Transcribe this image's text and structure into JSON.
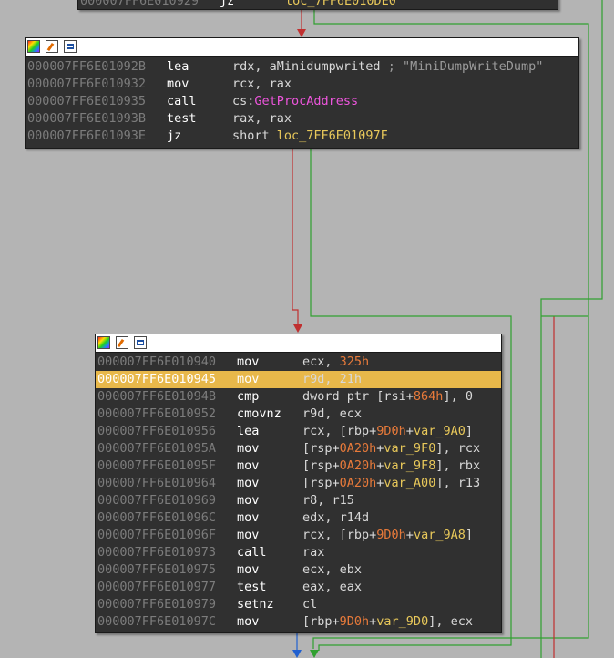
{
  "colors": {
    "background": "#b4b4b4",
    "node_bg": "#303030",
    "address": "#7c7c7c",
    "mnemonic": "#ffffff",
    "operand": "#d8d8d8",
    "number": "#e87a3a",
    "symbol": "#e8c85a",
    "import": "#ee55dd",
    "comment": "#9a9a9a",
    "highlight": "#e8b84a",
    "edge_false": "#c03030",
    "edge_true": "#30a030",
    "edge_normal": "#2060d0"
  },
  "node_header_icons": [
    "colors-icon",
    "rename-icon",
    "graph-overview-icon"
  ],
  "nodes": [
    {
      "id": "block-top-partial",
      "rows": [
        {
          "addr": "000007FF6E010929",
          "mnem": "jz",
          "ops": [
            {
              "t": "loc_7FF6E010DE0",
              "c": "sym"
            }
          ]
        }
      ]
    },
    {
      "id": "block-getprocaddress",
      "rows": [
        {
          "addr": "000007FF6E01092B",
          "mnem": "lea",
          "ops": [
            {
              "t": "rdx, "
            },
            {
              "t": "aMinidumpwrited",
              "c": "plain"
            },
            {
              "t": " ; \"MiniDumpWriteDump\"",
              "c": "cmt"
            }
          ]
        },
        {
          "addr": "000007FF6E010932",
          "mnem": "mov",
          "ops": [
            {
              "t": "rcx, rax"
            }
          ]
        },
        {
          "addr": "000007FF6E010935",
          "mnem": "call",
          "ops": [
            {
              "t": "cs:"
            },
            {
              "t": "GetProcAddress",
              "c": "imp"
            }
          ]
        },
        {
          "addr": "000007FF6E01093B",
          "mnem": "test",
          "ops": [
            {
              "t": "rax, rax"
            }
          ]
        },
        {
          "addr": "000007FF6E01093E",
          "mnem": "jz",
          "ops": [
            {
              "t": "short "
            },
            {
              "t": "loc_7FF6E01097F",
              "c": "sym"
            }
          ]
        }
      ]
    },
    {
      "id": "block-minidump-call",
      "rows": [
        {
          "addr": "000007FF6E010940",
          "mnem": "mov",
          "ops": [
            {
              "t": "ecx, "
            },
            {
              "t": "325h",
              "c": "num"
            }
          ]
        },
        {
          "addr": "000007FF6E010945",
          "mnem": "mov",
          "ops": [
            {
              "t": "r9d, 21h"
            }
          ],
          "highlight": true
        },
        {
          "addr": "000007FF6E01094B",
          "mnem": "cmp",
          "ops": [
            {
              "t": "dword ptr [rsi+"
            },
            {
              "t": "864h",
              "c": "num"
            },
            {
              "t": "], 0"
            }
          ]
        },
        {
          "addr": "000007FF6E010952",
          "mnem": "cmovnz",
          "ops": [
            {
              "t": "r9d, ecx"
            }
          ]
        },
        {
          "addr": "000007FF6E010956",
          "mnem": "lea",
          "ops": [
            {
              "t": "rcx, [rbp+"
            },
            {
              "t": "9D0h",
              "c": "num"
            },
            {
              "t": "+"
            },
            {
              "t": "var_9A0",
              "c": "sym"
            },
            {
              "t": "]"
            }
          ]
        },
        {
          "addr": "000007FF6E01095A",
          "mnem": "mov",
          "ops": [
            {
              "t": "[rsp+"
            },
            {
              "t": "0A20h",
              "c": "num"
            },
            {
              "t": "+"
            },
            {
              "t": "var_9F0",
              "c": "sym"
            },
            {
              "t": "], rcx"
            }
          ]
        },
        {
          "addr": "000007FF6E01095F",
          "mnem": "mov",
          "ops": [
            {
              "t": "[rsp+"
            },
            {
              "t": "0A20h",
              "c": "num"
            },
            {
              "t": "+"
            },
            {
              "t": "var_9F8",
              "c": "sym"
            },
            {
              "t": "], rbx"
            }
          ]
        },
        {
          "addr": "000007FF6E010964",
          "mnem": "mov",
          "ops": [
            {
              "t": "[rsp+"
            },
            {
              "t": "0A20h",
              "c": "num"
            },
            {
              "t": "+"
            },
            {
              "t": "var_A00",
              "c": "sym"
            },
            {
              "t": "], r13"
            }
          ]
        },
        {
          "addr": "000007FF6E010969",
          "mnem": "mov",
          "ops": [
            {
              "t": "r8, r15"
            }
          ]
        },
        {
          "addr": "000007FF6E01096C",
          "mnem": "mov",
          "ops": [
            {
              "t": "edx, r14d"
            }
          ]
        },
        {
          "addr": "000007FF6E01096F",
          "mnem": "mov",
          "ops": [
            {
              "t": "rcx, [rbp+"
            },
            {
              "t": "9D0h",
              "c": "num"
            },
            {
              "t": "+"
            },
            {
              "t": "var_9A8",
              "c": "sym"
            },
            {
              "t": "]"
            }
          ]
        },
        {
          "addr": "000007FF6E010973",
          "mnem": "call",
          "ops": [
            {
              "t": "rax"
            }
          ]
        },
        {
          "addr": "000007FF6E010975",
          "mnem": "mov",
          "ops": [
            {
              "t": "ecx, ebx"
            }
          ]
        },
        {
          "addr": "000007FF6E010977",
          "mnem": "test",
          "ops": [
            {
              "t": "eax, eax"
            }
          ]
        },
        {
          "addr": "000007FF6E010979",
          "mnem": "setnz",
          "ops": [
            {
              "t": "cl"
            }
          ]
        },
        {
          "addr": "000007FF6E01097C",
          "mnem": "mov",
          "ops": [
            {
              "t": "[rbp+"
            },
            {
              "t": "9D0h",
              "c": "num"
            },
            {
              "t": "+"
            },
            {
              "t": "var_9D0",
              "c": "sym"
            },
            {
              "t": "], ecx"
            }
          ]
        }
      ]
    }
  ]
}
